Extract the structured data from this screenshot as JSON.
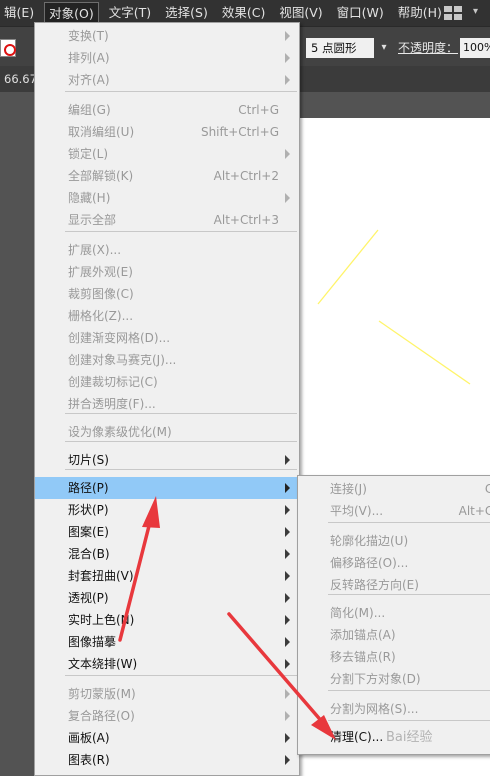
{
  "menubar": {
    "items": [
      "辑(E)",
      "对象(O)",
      "文字(T)",
      "选择(S)",
      "效果(C)",
      "视图(V)",
      "窗口(W)",
      "帮助(H)"
    ],
    "active_index": 1
  },
  "control_bar": {
    "brush": "5 点圆形",
    "opacity_label": "不透明度：",
    "opacity_value": "100%"
  },
  "doc": {
    "zoom": "66.67"
  },
  "object_menu": {
    "items": [
      {
        "label": "变换(T)",
        "shortcut": "",
        "submenu": true,
        "enabled": false
      },
      {
        "label": "排列(A)",
        "shortcut": "",
        "submenu": true,
        "enabled": false
      },
      {
        "label": "对齐(A)",
        "shortcut": "",
        "submenu": true,
        "enabled": false
      },
      {
        "label": "编组(G)",
        "shortcut": "Ctrl+G",
        "submenu": false,
        "enabled": false
      },
      {
        "label": "取消编组(U)",
        "shortcut": "Shift+Ctrl+G",
        "submenu": false,
        "enabled": false
      },
      {
        "label": "锁定(L)",
        "shortcut": "",
        "submenu": true,
        "enabled": false
      },
      {
        "label": "全部解锁(K)",
        "shortcut": "Alt+Ctrl+2",
        "submenu": false,
        "enabled": false
      },
      {
        "label": "隐藏(H)",
        "shortcut": "",
        "submenu": true,
        "enabled": false
      },
      {
        "label": "显示全部",
        "shortcut": "Alt+Ctrl+3",
        "submenu": false,
        "enabled": false
      },
      {
        "label": "扩展(X)...",
        "shortcut": "",
        "submenu": false,
        "enabled": false
      },
      {
        "label": "扩展外观(E)",
        "shortcut": "",
        "submenu": false,
        "enabled": false
      },
      {
        "label": "裁剪图像(C)",
        "shortcut": "",
        "submenu": false,
        "enabled": false
      },
      {
        "label": "栅格化(Z)...",
        "shortcut": "",
        "submenu": false,
        "enabled": false
      },
      {
        "label": "创建渐变网格(D)...",
        "shortcut": "",
        "submenu": false,
        "enabled": false
      },
      {
        "label": "创建对象马赛克(J)...",
        "shortcut": "",
        "submenu": false,
        "enabled": false
      },
      {
        "label": "创建裁切标记(C)",
        "shortcut": "",
        "submenu": false,
        "enabled": false
      },
      {
        "label": "拼合透明度(F)...",
        "shortcut": "",
        "submenu": false,
        "enabled": false
      },
      {
        "label": "设为像素级优化(M)",
        "shortcut": "",
        "submenu": false,
        "enabled": false
      },
      {
        "label": "切片(S)",
        "shortcut": "",
        "submenu": true,
        "enabled": true
      },
      {
        "label": "路径(P)",
        "shortcut": "",
        "submenu": true,
        "enabled": true,
        "highlighted": true
      },
      {
        "label": "形状(P)",
        "shortcut": "",
        "submenu": true,
        "enabled": true
      },
      {
        "label": "图案(E)",
        "shortcut": "",
        "submenu": true,
        "enabled": true
      },
      {
        "label": "混合(B)",
        "shortcut": "",
        "submenu": true,
        "enabled": true
      },
      {
        "label": "封套扭曲(V)",
        "shortcut": "",
        "submenu": true,
        "enabled": true
      },
      {
        "label": "透视(P)",
        "shortcut": "",
        "submenu": true,
        "enabled": true
      },
      {
        "label": "实时上色(N)",
        "shortcut": "",
        "submenu": true,
        "enabled": true
      },
      {
        "label": "图像描摹",
        "shortcut": "",
        "submenu": true,
        "enabled": true
      },
      {
        "label": "文本绕排(W)",
        "shortcut": "",
        "submenu": true,
        "enabled": true
      },
      {
        "label": "剪切蒙版(M)",
        "shortcut": "",
        "submenu": true,
        "enabled": false
      },
      {
        "label": "复合路径(O)",
        "shortcut": "",
        "submenu": true,
        "enabled": false
      },
      {
        "label": "画板(A)",
        "shortcut": "",
        "submenu": true,
        "enabled": true
      },
      {
        "label": "图表(R)",
        "shortcut": "",
        "submenu": true,
        "enabled": true
      }
    ]
  },
  "path_submenu": {
    "items": [
      {
        "label": "连接(J)",
        "shortcut": "Ct",
        "enabled": false
      },
      {
        "label": "平均(V)...",
        "shortcut": "Alt+Ct",
        "enabled": false
      },
      {
        "label": "轮廓化描边(U)",
        "shortcut": "",
        "enabled": false
      },
      {
        "label": "偏移路径(O)...",
        "shortcut": "",
        "enabled": false
      },
      {
        "label": "反转路径方向(E)",
        "shortcut": "",
        "enabled": false
      },
      {
        "label": "简化(M)...",
        "shortcut": "",
        "enabled": false
      },
      {
        "label": "添加锚点(A)",
        "shortcut": "",
        "enabled": false
      },
      {
        "label": "移去锚点(R)",
        "shortcut": "",
        "enabled": false
      },
      {
        "label": "分割下方对象(D)",
        "shortcut": "",
        "enabled": false
      },
      {
        "label": "分割为网格(S)...",
        "shortcut": "",
        "enabled": false
      },
      {
        "label": "清理(C)...",
        "shortcut": "",
        "enabled": true
      }
    ]
  },
  "watermark": "Bai经验",
  "colors": {
    "menu_bg": "#f0f0f0",
    "highlight": "#91c9f7",
    "arrow": "#e8383d",
    "path_stroke": "#fff46a"
  }
}
